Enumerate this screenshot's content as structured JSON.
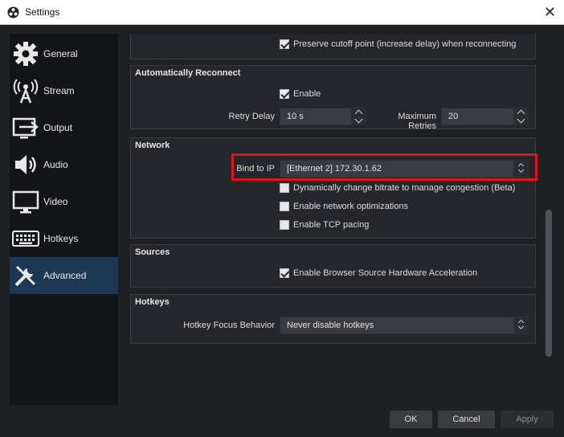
{
  "window": {
    "title": "Settings"
  },
  "sidebar": {
    "items": [
      {
        "label": "General",
        "icon": "gear-icon"
      },
      {
        "label": "Stream",
        "icon": "antenna-icon"
      },
      {
        "label": "Output",
        "icon": "output-icon"
      },
      {
        "label": "Audio",
        "icon": "speaker-icon"
      },
      {
        "label": "Video",
        "icon": "monitor-icon"
      },
      {
        "label": "Hotkeys",
        "icon": "keyboard-icon"
      },
      {
        "label": "Advanced",
        "icon": "tools-icon",
        "active": true
      }
    ]
  },
  "top": {
    "preserve_cutoff_label": "Preserve cutoff point (increase delay) when reconnecting",
    "preserve_cutoff_checked": true
  },
  "reconnect": {
    "title": "Automatically Reconnect",
    "enable_label": "Enable",
    "enable_checked": true,
    "retry_delay_label": "Retry Delay",
    "retry_delay_value": "10 s",
    "max_retries_label": "Maximum Retries",
    "max_retries_value": "20"
  },
  "network": {
    "title": "Network",
    "bind_label": "Bind to IP",
    "bind_value": "[Ethernet 2] 172.30.1.62",
    "dynamic_bitrate_label": "Dynamically change bitrate to manage congestion (Beta)",
    "net_opt_label": "Enable network optimizations",
    "tcp_pacing_label": "Enable TCP pacing"
  },
  "sources": {
    "title": "Sources",
    "browser_hw_label": "Enable Browser Source Hardware Acceleration",
    "browser_hw_checked": true
  },
  "hotkeys": {
    "title": "Hotkeys",
    "focus_label": "Hotkey Focus Behavior",
    "focus_value": "Never disable hotkeys"
  },
  "buttons": {
    "ok": "OK",
    "cancel": "Cancel",
    "apply": "Apply"
  },
  "colors": {
    "highlight": "#e3131b",
    "active_nav": "#1c3855",
    "background": "#1f2024"
  }
}
